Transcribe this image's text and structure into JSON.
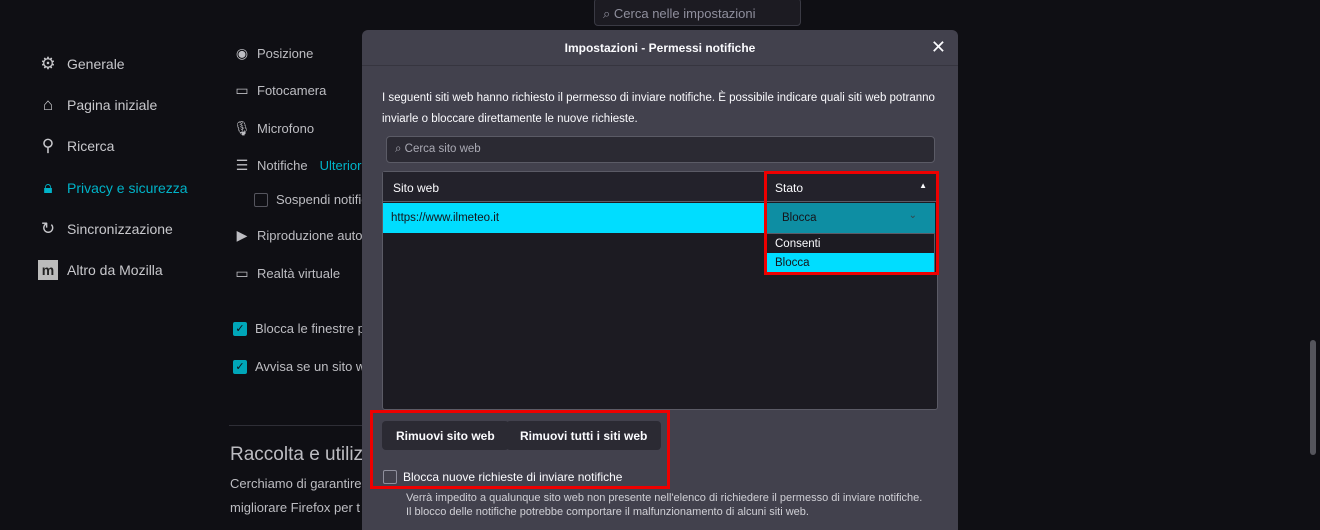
{
  "top_search": {
    "placeholder": "Cerca nelle impostazioni"
  },
  "sidebar": {
    "items": [
      {
        "label": "Generale",
        "icon": "gear-icon"
      },
      {
        "label": "Pagina iniziale",
        "icon": "home-icon"
      },
      {
        "label": "Ricerca",
        "icon": "search-icon"
      },
      {
        "label": "Privacy e sicurezza",
        "icon": "lock-icon",
        "active": true
      },
      {
        "label": "Sincronizzazione",
        "icon": "sync-icon"
      },
      {
        "label": "Altro da Mozilla",
        "icon": "mozilla-icon"
      }
    ]
  },
  "permissions": {
    "posizione": "Posizione",
    "fotocamera": "Fotocamera",
    "microfono": "Microfono",
    "notifiche": "Notifiche",
    "ulteriori": "Ulterior",
    "sospendi": "Sospendi notific",
    "riproduzione": "Riproduzione auto",
    "realta": "Realtà virtuale",
    "blocca_popup": "Blocca le finestre po",
    "avvisa": "Avvisa se un sito we"
  },
  "section": {
    "title": "Raccolta e utilizz",
    "line1": "Cerchiamo di garantire",
    "line2": "migliorare Firefox per t"
  },
  "dialog": {
    "title": "Impostazioni - Permessi notifiche",
    "description": "I seguenti siti web hanno richiesto il permesso di inviare notifiche. È possibile indicare quali siti web potranno inviarle o bloccare direttamente le nuove richieste.",
    "search_placeholder": "Cerca sito web",
    "columns": {
      "site": "Sito web",
      "status": "Stato"
    },
    "rows": [
      {
        "site": "https://www.ilmeteo.it",
        "status": "Blocca"
      }
    ],
    "status_options": [
      "Consenti",
      "Blocca"
    ],
    "remove_button": "Rimuovi sito web",
    "remove_all_button": "Rimuovi tutti i siti web",
    "block_new_label": "Blocca nuove richieste di inviare notifiche",
    "block_new_note": "Verrà impedito a qualunque sito web non presente nell'elenco di richiedere il permesso di inviare notifiche. Il blocco delle notifiche potrebbe comportare il malfunzionamento di alcuni siti web."
  }
}
